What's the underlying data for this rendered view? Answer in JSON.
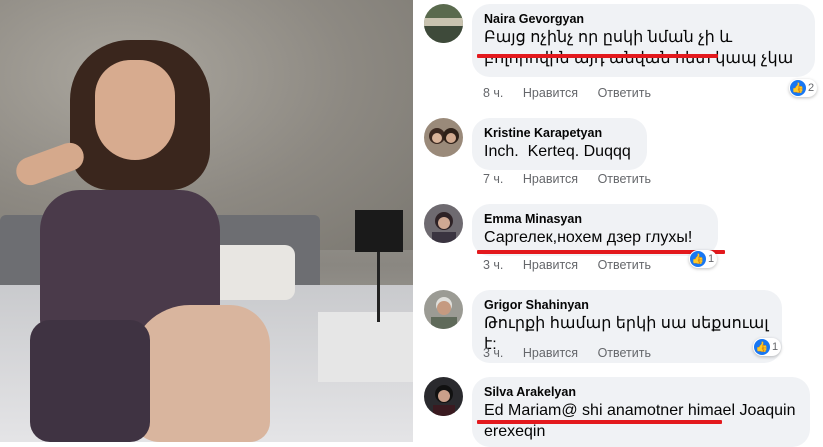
{
  "comments": [
    {
      "author": "Naira Gevorgyan",
      "text": "Բայց ոչինչ որ ըսկի նման չի և բոլորովին այդ անվան հետ կապ չկա",
      "time": "8 ч.",
      "like_label": "Нравится",
      "reply_label": "Ответить",
      "reactions": "2",
      "avatar_color": "#5a6a4e"
    },
    {
      "author": "Kristine Karapetyan",
      "text": "Inch.  Kerteq. Duqqq",
      "time": "7 ч.",
      "like_label": "Нравится",
      "reply_label": "Ответить",
      "avatar_color": "#6b4a3e"
    },
    {
      "author": "Emma Minasyan",
      "text": "Саргелек,нохем дзер глухы!",
      "time": "3 ч.",
      "like_label": "Нравится",
      "reply_label": "Ответить",
      "reactions": "1",
      "avatar_color": "#4e4a55"
    },
    {
      "author": "Grigor Shahinyan",
      "text": "Թուրքի համար երկի սա սեքսուալ է:",
      "time": "3 ч.",
      "like_label": "Нравится",
      "reply_label": "Ответить",
      "reactions": "1",
      "avatar_color": "#8a8a82"
    },
    {
      "author": "Silva Arakelyan",
      "text": "Ed Mariam@ shi anamotner himael Joaquin erexeqin",
      "avatar_color": "#2a2a2e"
    }
  ],
  "colors": {
    "underline": "#e3191d",
    "like_blue": "#1877f2",
    "bubble": "#f0f2f5"
  }
}
